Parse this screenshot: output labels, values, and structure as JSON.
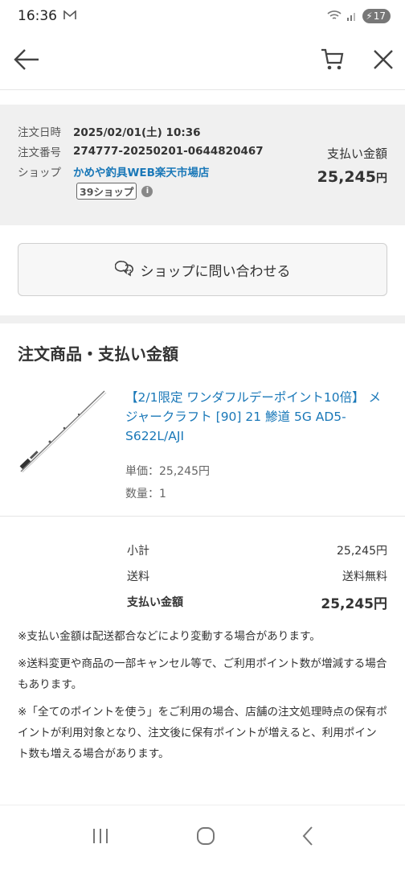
{
  "status_bar": {
    "time": "16:36",
    "battery": "17"
  },
  "header": {
    "back": "back",
    "cart": "cart",
    "close": "close"
  },
  "order": {
    "date_label": "注文日時",
    "date_value": "2025/02/01(土) 10:36",
    "number_label": "注文番号",
    "number_value": "274777-20250201-0644820467",
    "shop_label": "ショップ",
    "shop_value": "かめや釣具WEB楽天市場店",
    "shop_badge": "39ショップ",
    "pay_label": "支払い金額",
    "pay_amount": "25,245",
    "pay_unit": "円"
  },
  "contact_button": "ショップに問い合わせる",
  "section_title": "注文商品・支払い金額",
  "product": {
    "name": "【2/1限定 ワンダフルデーポイント10倍】 メジャークラフト [90] 21 鯵道 5G AD5-S622L/AJI",
    "unit_price": "単価：25,245円",
    "quantity": "数量：1"
  },
  "summary": [
    {
      "label": "小計",
      "value": "25,245円"
    },
    {
      "label": "送料",
      "value": "送料無料"
    },
    {
      "label": "支払い金額",
      "value": "25,245円"
    }
  ],
  "notes": [
    "※支払い金額は配送都合などにより変動する場合があります。",
    "※送料変更や商品の一部キャンセル等で、ご利用ポイント数が増減する場合もあります。",
    "※「全てのポイントを使う」をご利用の場合、店舗の注文処理時点の保有ポイントが利用対象となり、注文後に保有ポイントが増えると、利用ポイント数も増える場合があります。"
  ],
  "icons": {
    "back": "arrow-left-icon",
    "cart": "cart-icon",
    "close": "close-icon",
    "chat": "chat-bubble-icon",
    "info": "info-icon"
  }
}
